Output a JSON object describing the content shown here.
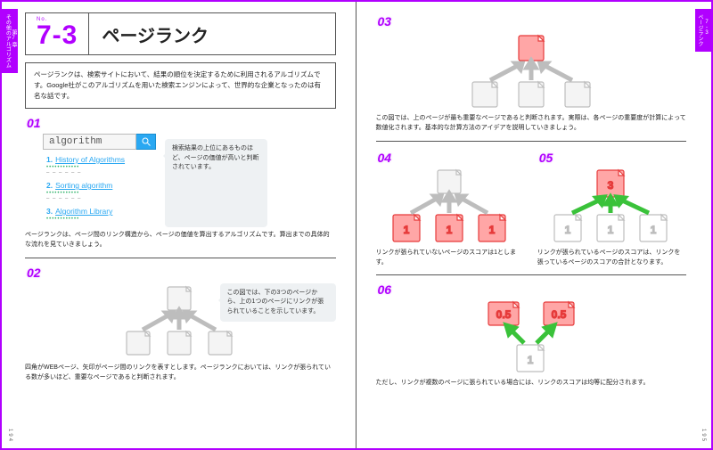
{
  "chapter": {
    "label": "第7章",
    "subtitle": "その他のアルゴリズム"
  },
  "side_right": {
    "num": "7-3",
    "title": "ページランク"
  },
  "page_left": "194",
  "page_right": "195",
  "header": {
    "no": "No.",
    "num": "7-3",
    "title": "ページランク"
  },
  "intro": "ページランクは、検索サイトにおいて、結果の順位を決定するために利用されるアルゴリズムです。Google社がこのアルゴリズムを用いた検索エンジンによって、世界的な企業となったのは有名な話です。",
  "sections": {
    "s01": {
      "label": "01",
      "search_value": "algorithm",
      "balloon": "検索結果の上位にあるものほど、ページの価値が高いと判断されています。",
      "results": [
        {
          "rank": "1.",
          "title": "History of Algorithms"
        },
        {
          "rank": "2.",
          "title": "Sorting algorithm"
        },
        {
          "rank": "3.",
          "title": "Algorithm Library"
        }
      ],
      "caption": "ページランクは、ページ間のリンク構造から、ページの価値を算出するアルゴリズムです。算出までの具体的な流れを見ていきましょう。"
    },
    "s02": {
      "label": "02",
      "balloon": "この図では、下の3つのページから、上の1つのページにリンクが張られていることを示しています。",
      "caption": "四角がWEBページ、矢印がページ間のリンクを表すとします。ページランクにおいては、リンクが張られている数が多いほど、重要なページであると判断されます。"
    },
    "s03": {
      "label": "03",
      "caption": "この図では、上のページが最も重要なページであると判断されます。実際は、各ページの重要度が計算によって数値化されます。基本的な計算方法のアイデアを説明していきましょう。"
    },
    "s04": {
      "label": "04",
      "scores": [
        "1",
        "1",
        "1"
      ],
      "caption": "リンクが張られていないページのスコアは1とします。"
    },
    "s05": {
      "label": "05",
      "top_score": "3",
      "scores": [
        "1",
        "1",
        "1"
      ],
      "caption": "リンクが張られているページのスコアは、リンクを張っているページのスコアの合計となります。"
    },
    "s06": {
      "label": "06",
      "top_scores": [
        "0.5",
        "0.5"
      ],
      "bottom_score": "1",
      "caption": "ただし、リンクが複数のページに張られている場合には、リンクのスコアは均等に配分されます。"
    }
  }
}
